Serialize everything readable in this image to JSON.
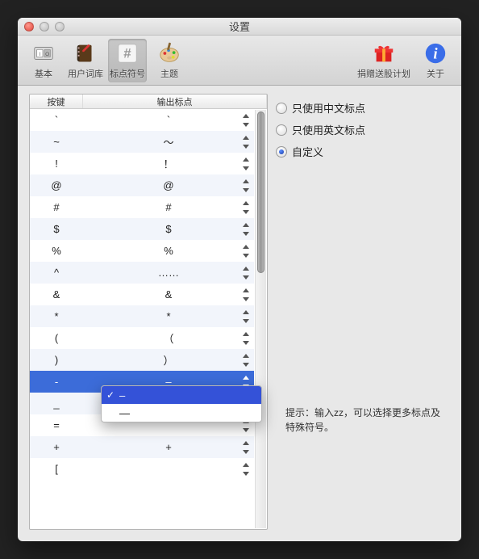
{
  "window": {
    "title": "设置"
  },
  "toolbar": {
    "items": [
      {
        "label": "基本"
      },
      {
        "label": "用户词库"
      },
      {
        "label": "标点符号"
      },
      {
        "label": "主题"
      }
    ],
    "right": [
      {
        "label": "捐赠送股计划"
      },
      {
        "label": "关于"
      }
    ]
  },
  "table": {
    "headers": {
      "key": "按键",
      "output": "输出标点"
    },
    "rows": [
      {
        "key": "`",
        "output": "`"
      },
      {
        "key": "~",
        "output": "～"
      },
      {
        "key": "!",
        "output": "！"
      },
      {
        "key": "@",
        "output": "@"
      },
      {
        "key": "#",
        "output": "#"
      },
      {
        "key": "$",
        "output": "$"
      },
      {
        "key": "%",
        "output": "%"
      },
      {
        "key": "^",
        "output": "……"
      },
      {
        "key": "&",
        "output": "&"
      },
      {
        "key": "*",
        "output": "*"
      },
      {
        "key": "(",
        "output": "（"
      },
      {
        "key": ")",
        "output": "）"
      },
      {
        "key": "-",
        "output": "–"
      },
      {
        "key": "_",
        "output": ""
      },
      {
        "key": "=",
        "output": ""
      },
      {
        "key": "+",
        "output": "+"
      },
      {
        "key": "[",
        "output": ""
      }
    ],
    "selected_index": 12
  },
  "popup": {
    "items": [
      {
        "label": "–",
        "checked": true,
        "selected": true
      },
      {
        "label": "—",
        "checked": false,
        "selected": false
      }
    ]
  },
  "radios": {
    "options": [
      {
        "label": "只使用中文标点",
        "selected": false
      },
      {
        "label": "只使用英文标点",
        "selected": false
      },
      {
        "label": "自定义",
        "selected": true
      }
    ]
  },
  "hint": "提示：输入zz，可以选择更多标点及特殊符号。"
}
